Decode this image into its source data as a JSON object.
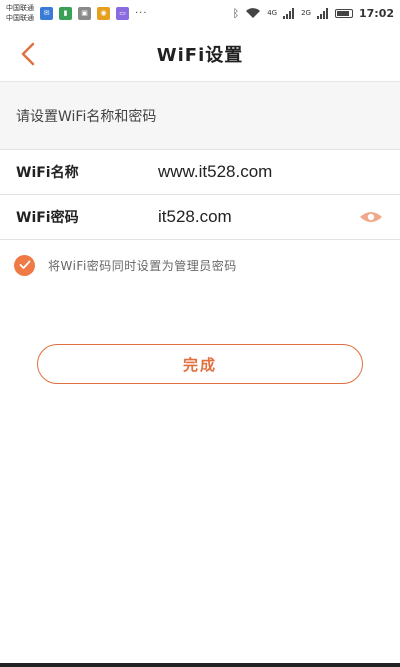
{
  "status_bar": {
    "carrier_line1": "中国联通",
    "carrier_line2": "中国联通",
    "notifications": [
      {
        "icon": "chat-icon",
        "color": "#3b7bd8"
      },
      {
        "icon": "chart-icon",
        "color": "#3aa055"
      },
      {
        "icon": "photo-icon",
        "color": "#8a8a8a"
      },
      {
        "icon": "weibo-icon",
        "color": "#e6a020"
      },
      {
        "icon": "message-icon",
        "color": "#8a6be0"
      }
    ],
    "more_dots": "···",
    "signal_4g": "4G",
    "signal_2g": "2G",
    "time": "17:02"
  },
  "header": {
    "title": "WiFi设置"
  },
  "section": {
    "title": "请设置WiFi名称和密码"
  },
  "form": {
    "ssid_label": "WiFi名称",
    "ssid_value": "www.it528.com",
    "password_label": "WiFi密码",
    "password_value": "it528.com"
  },
  "option": {
    "checked": true,
    "label": "将WiFi密码同时设置为管理员密码"
  },
  "actions": {
    "done_label": "完成"
  },
  "colors": {
    "accent": "#e07040",
    "check_fill": "#f07a45",
    "eye": "#f2a88a"
  }
}
